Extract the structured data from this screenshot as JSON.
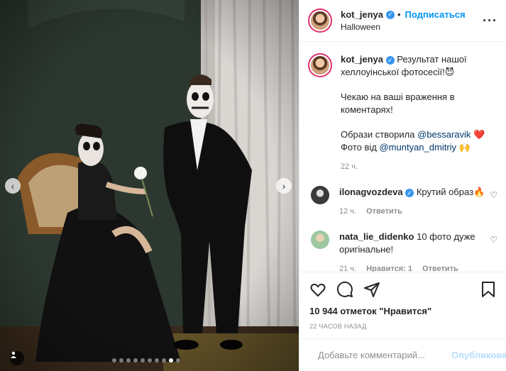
{
  "header": {
    "username": "kot_jenya",
    "follow_label": "Подписаться",
    "location": "Halloween",
    "more_icon": "more-horizontal-icon"
  },
  "caption": {
    "username": "kot_jenya",
    "text_line1": "Результат нашої хеллоуінської фотосесії!😈",
    "text_para2": "Чекаю на ваші враження в коментарях!",
    "text_para3_prefix": "Образи створила ",
    "mention1": "@bessaravik",
    "text_para3_suffix": " ❤️",
    "text_para4_prefix": "Фото від ",
    "mention2": "@muntyan_dmitriy",
    "text_para4_suffix": " 🙌",
    "time": "22 ч."
  },
  "comments": [
    {
      "username": "ilonagvozdeva",
      "verified": true,
      "text": "Крутий образ🔥",
      "time": "12 ч.",
      "likes": "",
      "reply": "Ответить",
      "avatar_color": "#3a3a3a"
    },
    {
      "username": "nata_lie_didenko",
      "verified": false,
      "text": "10 фото дуже оригінальне!",
      "time": "21 ч.",
      "likes": "Нравится: 1",
      "reply": "Ответить",
      "avatar_color": "#9cc7a0"
    }
  ],
  "actions": {
    "like_icon": "heart-icon",
    "comment_icon": "comment-icon",
    "share_icon": "share-icon",
    "save_icon": "bookmark-icon"
  },
  "likes_text": "10 944 отметок \"Нравится\"",
  "date_text": "22 ЧАСОВ НАЗАД",
  "add_comment": {
    "placeholder": "Добавьте комментарий...",
    "post_label": "Опубликовать",
    "emoji_icon": "emoji-icon"
  },
  "carousel": {
    "total": 10,
    "active": 9
  },
  "colors": {
    "accent": "#0095f6",
    "verified": "#3897f0",
    "muted": "#8e8e8e"
  }
}
